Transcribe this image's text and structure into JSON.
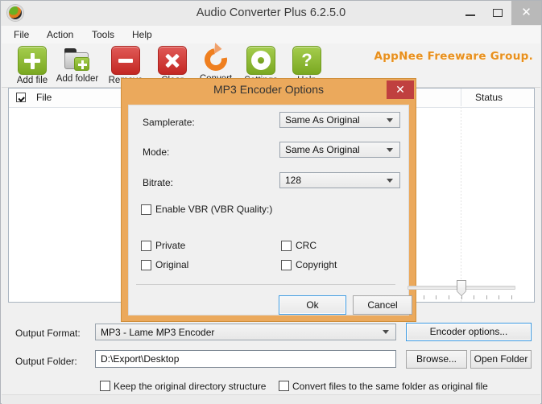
{
  "window": {
    "title": "Audio Converter Plus 6.2.5.0",
    "app_icon": "app-logo-icon",
    "minimize_label": "–",
    "maximize_label": "□",
    "close_label": "✕"
  },
  "menu": {
    "items": [
      {
        "label": "File"
      },
      {
        "label": "Action"
      },
      {
        "label": "Tools"
      },
      {
        "label": "Help"
      }
    ]
  },
  "toolbar": {
    "items": [
      {
        "label": "Add file",
        "icon": "add-file-icon"
      },
      {
        "label": "Add folder",
        "icon": "add-folder-icon"
      },
      {
        "label": "Remove",
        "icon": "remove-icon"
      },
      {
        "label": "Clear",
        "icon": "clear-icon"
      },
      {
        "label": "Convert",
        "icon": "convert-icon"
      },
      {
        "label": "Settings",
        "icon": "settings-gear-icon"
      },
      {
        "label": "Help",
        "icon": "help-question-icon"
      }
    ],
    "watermark": "AppNee Freeware Group."
  },
  "file_list": {
    "columns": [
      {
        "label": "File"
      },
      {
        "label": "Status"
      }
    ],
    "select_all_checked": true,
    "rows": []
  },
  "output": {
    "format_label": "Output Format:",
    "format_value": "MP3  - Lame MP3 Encoder",
    "encoder_options_button": "Encoder options...",
    "folder_label": "Output Folder:",
    "folder_value": "D:\\Export\\Desktop",
    "browse_button": "Browse...",
    "open_folder_button": "Open Folder",
    "keep_structure_label": "Keep the original directory structure",
    "keep_structure_checked": false,
    "same_folder_label": "Convert files to the same folder as original file",
    "same_folder_checked": false
  },
  "dialog": {
    "title": "MP3 Encoder Options",
    "close_label": "✕",
    "fields": [
      {
        "label": "Samplerate:",
        "value": "Same As Original"
      },
      {
        "label": "Mode:",
        "value": "Same As Original"
      },
      {
        "label": "Bitrate:",
        "value": "128"
      }
    ],
    "vbr": {
      "label": "Enable VBR (VBR Quality:)",
      "checked": false,
      "slider_position_percent": 50,
      "tick_count": 9
    },
    "checkboxes": [
      {
        "label": "Private",
        "checked": false
      },
      {
        "label": "CRC",
        "checked": false
      },
      {
        "label": "Original",
        "checked": false
      },
      {
        "label": "Copyright",
        "checked": false
      }
    ],
    "ok_button": "Ok",
    "cancel_button": "Cancel"
  },
  "colors": {
    "dialog_border": "#eba95c",
    "dialog_close": "#c0403f",
    "watermark": "#e8901e",
    "focus_blue": "#3c99e0",
    "toolbar_green": "#7aa821",
    "toolbar_red": "#c32723",
    "convert_orange": "#ef7f1f"
  }
}
